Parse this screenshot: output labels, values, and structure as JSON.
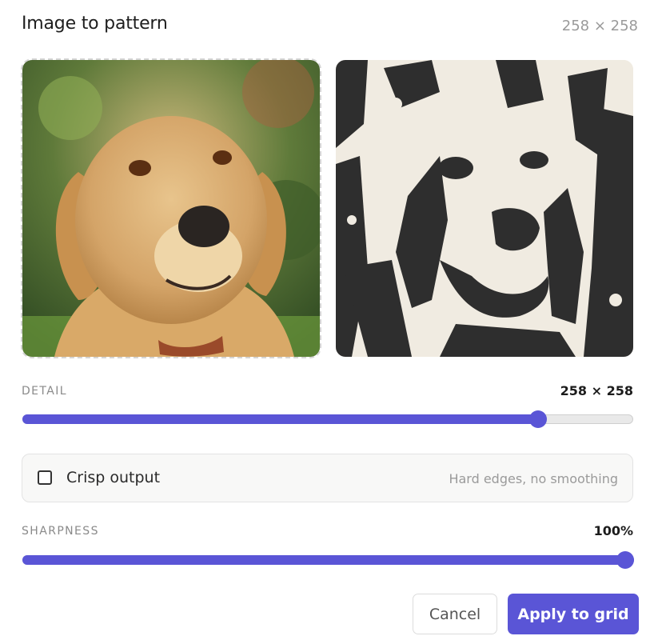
{
  "dialog": {
    "title": "Image to pattern",
    "dimensions": "258 × 258"
  },
  "images": {
    "source_icon": "photo-dog-icon",
    "preview_icon": "pattern-preview-icon"
  },
  "detail": {
    "label": "DETAIL",
    "value": "258 × 258",
    "level": 0.843
  },
  "crisp": {
    "label": "Crisp output",
    "hint": "Hard edges, no smoothing",
    "checked": false
  },
  "sharpness": {
    "label": "SHARPNESS",
    "value": "100%",
    "level": 1.0
  },
  "buttons": {
    "cancel": "Cancel",
    "apply": "Apply to grid"
  },
  "colors": {
    "accent": "#5a55d6",
    "pattern_dark": "#2e2e2e",
    "pattern_light": "#f0ebe1"
  }
}
